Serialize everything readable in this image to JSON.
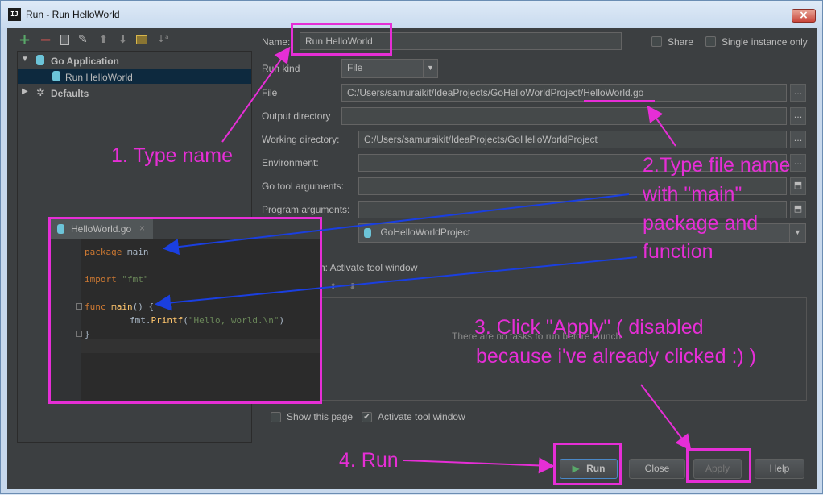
{
  "window": {
    "title": "Run - Run HelloWorld",
    "app_icon_text": "IJ"
  },
  "toolbar_icons": [
    "add-icon",
    "remove-icon",
    "copy-icon",
    "wrench-icon",
    "move-up-icon",
    "move-down-icon",
    "folder-icon",
    "sort-icon"
  ],
  "tree": {
    "go_application": "Go Application",
    "run_config": "Run HelloWorld",
    "defaults": "Defaults"
  },
  "form": {
    "name_label": "Name:",
    "name_value": "Run HelloWorld",
    "share_label": "Share",
    "single_instance_label": "Single instance only",
    "run_kind_label": "Run kind",
    "run_kind_value": "File",
    "file_label": "File",
    "file_value": "C:/Users/samuraikit/IdeaProjects/GoHelloWorldProject/HelloWorld.go",
    "output_dir_label": "Output directory",
    "output_dir_value": "",
    "working_dir_label": "Working directory:",
    "working_dir_value": "C:/Users/samuraikit/IdeaProjects/GoHelloWorldProject",
    "environment_label": "Environment:",
    "go_tool_args_label": "Go tool arguments:",
    "program_args_label": "Program arguments:",
    "module_value": "GoHelloWorldProject",
    "before_launch_label": "h: Activate tool window",
    "no_tasks_text": "There are no tasks to run before launch",
    "show_page_label": "Show this page",
    "activate_tool_label": "Activate tool window",
    "dots": "..."
  },
  "buttons": {
    "run": "Run",
    "close": "Close",
    "apply": "Apply",
    "help": "Help"
  },
  "editor": {
    "tab": "HelloWorld.go",
    "line1_kw": "package",
    "line1_rest": " main",
    "line2_kw": "import",
    "line2_str": " \"fmt\"",
    "line3_kw": "func",
    "line3_fn": " main",
    "line3_rest": "() {",
    "line4_pre": "fmt.",
    "line4_fn": "Printf",
    "line4_open": "(",
    "line4_str": "\"Hello, world.\\n\"",
    "line4_close": ")",
    "line5": "}"
  },
  "annotations": {
    "step1": "1. Type name",
    "step2_l1": "2.Type file name",
    "step2_l2": "with \"main\"",
    "step2_l3": "package and",
    "step2_l4": "function",
    "step3_l1": "3. Click \"Apply\" ( disabled",
    "step3_l2": "because i've already clicked :)  )",
    "step4": "4. Run"
  },
  "colors": {
    "annotation": "#e62ed6",
    "arrow_blue": "#1a3fe0",
    "ide_bg": "#3c3f41",
    "run_green": "#59a869"
  }
}
